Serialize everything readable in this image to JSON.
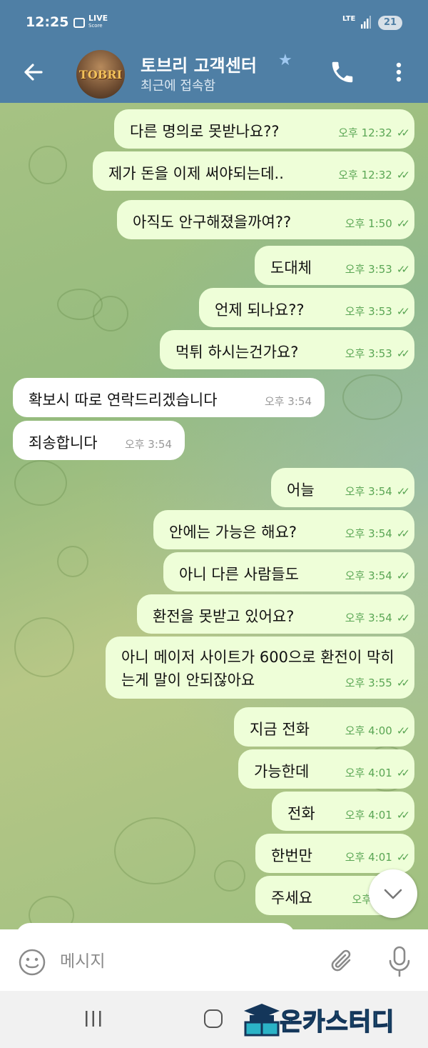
{
  "status_bar": {
    "time": "12:25",
    "live_top": "LIVE",
    "live_bottom": "Score",
    "network": "LTE",
    "battery": "21"
  },
  "header": {
    "title": "토브리 고객센터",
    "status": "최근에 접속함",
    "avatar_text": "TOBRI"
  },
  "messages": [
    {
      "dir": "out",
      "text": "다른 명의로 못받나요??",
      "time": "오후 12:32"
    },
    {
      "dir": "out",
      "text": "제가 돈을 이제 써야되는데..",
      "time": "오후 12:32"
    },
    {
      "dir": "out",
      "text": "아직도 안구해졌을까여??",
      "time": "오후 1:50"
    },
    {
      "dir": "out",
      "text": "도대체",
      "time": "오후 3:53"
    },
    {
      "dir": "out",
      "text": "언제 되나요??",
      "time": "오후 3:53"
    },
    {
      "dir": "out",
      "text": "먹튀 하시는건가요?",
      "time": "오후 3:53"
    },
    {
      "dir": "in",
      "text": "확보시 따로 연락드리겠습니다",
      "time": "오후 3:54"
    },
    {
      "dir": "in",
      "text": "죄송합니다",
      "time": "오후 3:54"
    },
    {
      "dir": "out",
      "text": "어늘",
      "time": "오후 3:54"
    },
    {
      "dir": "out",
      "text": "안에는 가능은 해요?",
      "time": "오후 3:54"
    },
    {
      "dir": "out",
      "text": "아니 다른 사람들도",
      "time": "오후 3:54"
    },
    {
      "dir": "out",
      "text": "환전을 못받고 있어요?",
      "time": "오후 3:54"
    },
    {
      "dir": "out",
      "text": "아니 메이저 사이트가 600으로 환전이 막히는게 말이 안되잖아요",
      "time": "오후 3:55"
    },
    {
      "dir": "out",
      "text": "지금 전화",
      "time": "오후 4:00"
    },
    {
      "dir": "out",
      "text": "가능한데",
      "time": "오후 4:01"
    },
    {
      "dir": "out",
      "text": "전화",
      "time": "오후 4:01"
    },
    {
      "dir": "out",
      "text": "한번만",
      "time": "오후 4:01"
    },
    {
      "dir": "out",
      "text": "주세요",
      "time": "오후 4:0"
    }
  ],
  "input": {
    "placeholder": "메시지"
  },
  "watermark": {
    "text": "온카스터디"
  },
  "colors": {
    "header": "#4f7fa5",
    "outgoing_bubble": "#eefed8",
    "incoming_bubble": "#ffffff",
    "read_check": "#5aa654"
  },
  "icons": {
    "back": "arrow-left-icon",
    "call": "phone-icon",
    "menu": "more-vertical-icon",
    "emoji": "smile-icon",
    "attach": "paperclip-icon",
    "mic": "microphone-icon",
    "scroll": "chevron-down-icon"
  }
}
